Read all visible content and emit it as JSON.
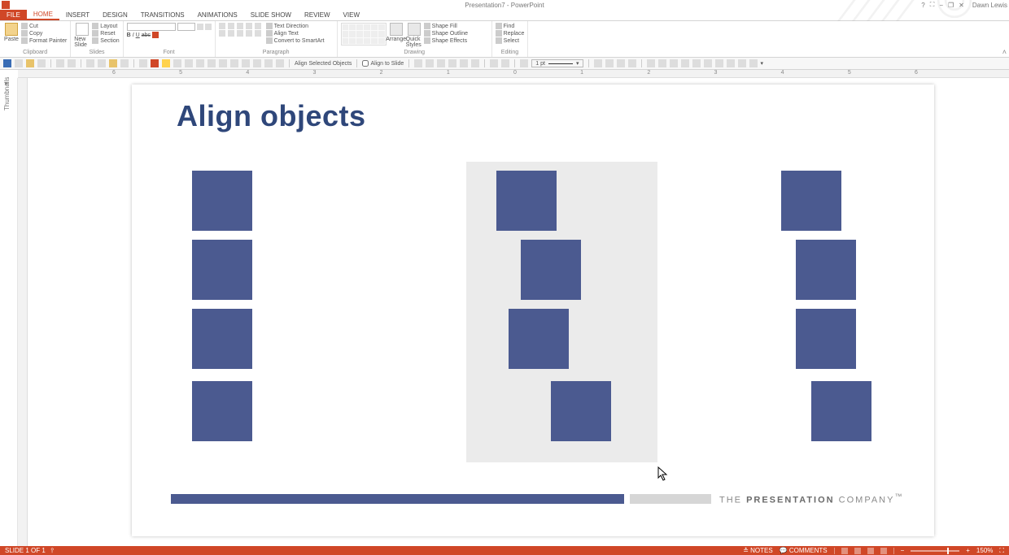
{
  "app": {
    "title": "Presentation7 - PowerPoint",
    "user": "Dawn Lewis"
  },
  "win": {
    "help": "?",
    "fullscreen": "⛶",
    "min": "−",
    "restore": "❐",
    "close": "✕"
  },
  "tabs": {
    "file": "FILE",
    "home": "HOME",
    "insert": "INSERT",
    "design": "DESIGN",
    "transitions": "TRANSITIONS",
    "animations": "ANIMATIONS",
    "slideshow": "SLIDE SHOW",
    "review": "REVIEW",
    "view": "VIEW"
  },
  "ribbon": {
    "clipboard": {
      "label": "Clipboard",
      "paste": "Paste",
      "cut": "Cut",
      "copy": "Copy",
      "format_painter": "Format Painter"
    },
    "slides": {
      "label": "Slides",
      "new_slide": "New Slide",
      "layout": "Layout",
      "reset": "Reset",
      "section": "Section"
    },
    "font": {
      "label": "Font",
      "name": "",
      "size": "",
      "bold": "B",
      "italic": "I",
      "underline": "U",
      "strike": "abc"
    },
    "paragraph": {
      "label": "Paragraph",
      "text_direction": "Text Direction",
      "align_text": "Align Text",
      "convert_smartart": "Convert to SmartArt"
    },
    "drawing": {
      "label": "Drawing",
      "arrange": "Arrange",
      "quick_styles": "Quick Styles",
      "shape_fill": "Shape Fill",
      "shape_outline": "Shape Outline",
      "shape_effects": "Shape Effects"
    },
    "editing": {
      "label": "Editing",
      "find": "Find",
      "replace": "Replace",
      "select": "Select"
    }
  },
  "qat": {
    "align_selected": "Align Selected Objects",
    "align_to_slide": "Align to Slide",
    "weight": "1 pt"
  },
  "thumb": {
    "label": "Thumbnails",
    "expand": "▸"
  },
  "ruler": {
    "marks": [
      "6",
      "5",
      "4",
      "3",
      "2",
      "1",
      "0",
      "1",
      "2",
      "3",
      "4",
      "5",
      "6"
    ]
  },
  "slide": {
    "title": "Align objects",
    "company_pre": "THE ",
    "company_bold": "PRESENTATION",
    "company_post": " COMPANY",
    "company_tm": "™"
  },
  "status": {
    "left": "SLIDE 1 OF 1",
    "notes": "NOTES",
    "comments": "COMMENTS",
    "zoom": "150%"
  }
}
